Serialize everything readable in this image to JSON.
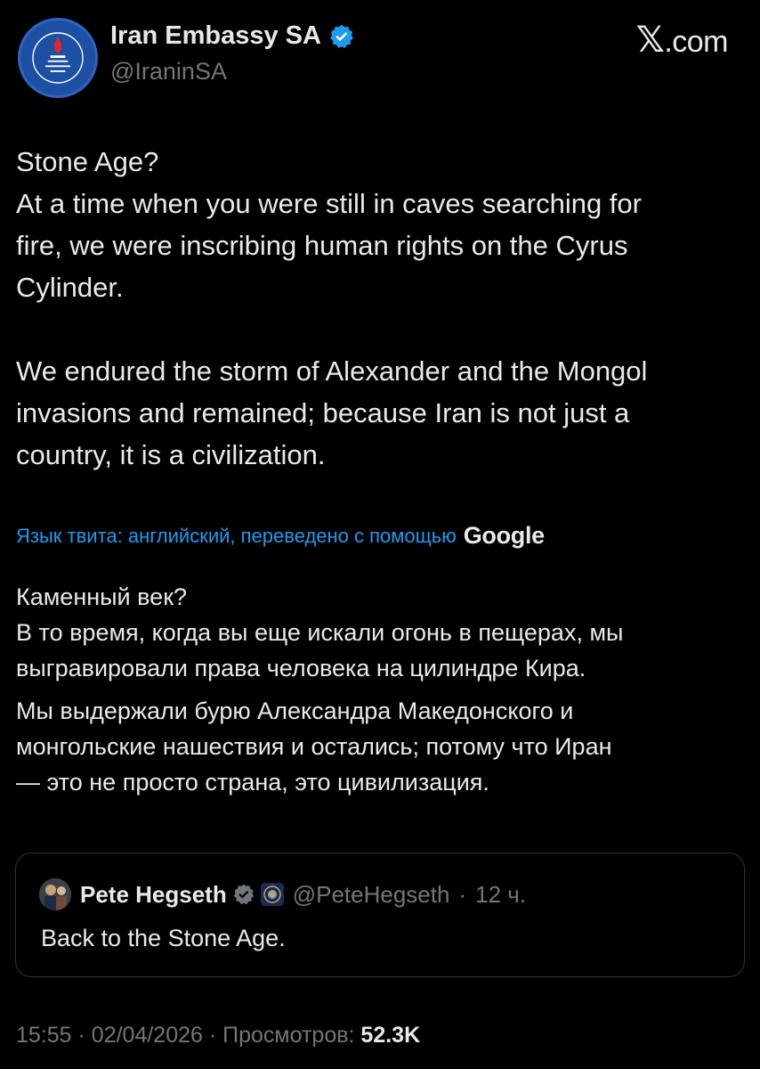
{
  "header": {
    "display_name": "Iran Embassy SA",
    "handle": "@IraninSA",
    "site_x": "𝕏",
    "site_suffix": ".com"
  },
  "tweet": {
    "paragraph1": [
      "Stone Age?",
      "At a time when you were still in caves searching for",
      "fire, we were inscribing human rights on the Cyrus",
      "Cylinder."
    ],
    "paragraph2": [
      "We endured the storm of Alexander and the Mongol",
      "invasions and remained; because Iran is not just a",
      "country, it is a civilization."
    ]
  },
  "translation": {
    "notice": "Язык твита: английский, переведено с помощью",
    "provider": "Google",
    "paragraph1": [
      "Каменный век?",
      "В то время, когда вы еще искали огонь в пещерах, мы",
      "выгравировали права человека на цилиндре Кира."
    ],
    "paragraph2": [
      "Мы выдержали бурю Александра Македонского и",
      "монгольские нашествия и остались; потому что Иран",
      "— это не просто страна, это цивилизация."
    ]
  },
  "quote": {
    "display_name": "Pete Hegseth",
    "handle": "@PeteHegseth",
    "separator": "·",
    "time": "12 ч.",
    "text": "Back to the Stone Age."
  },
  "footer": {
    "time": "15:55",
    "sep1": "·",
    "date": "02/04/2026",
    "sep2": "·",
    "views_label": "Просмотров:",
    "views_count": "52.3K"
  },
  "colors": {
    "background": "#000000",
    "text": "#e7e9ea",
    "muted": "#71767b",
    "link": "#1d9bf0",
    "verified": "#1d9bf0",
    "border": "#2f3336"
  },
  "icons": {
    "verified": "verified-badge-icon",
    "seal": "dod-seal-icon",
    "avatar": "embassy-emblem-avatar"
  }
}
